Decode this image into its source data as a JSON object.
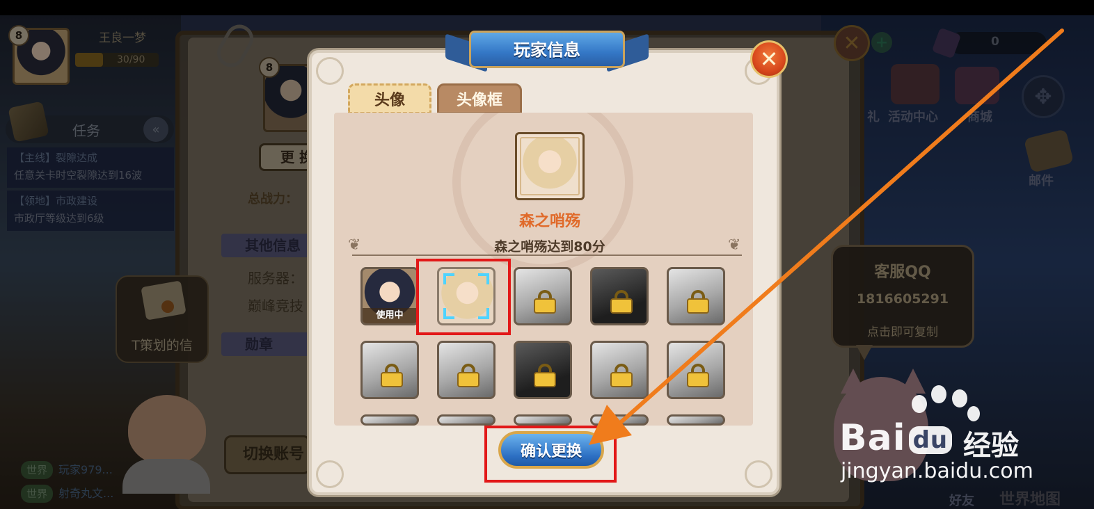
{
  "hud": {
    "player_level": "8",
    "player_name": "王良一梦",
    "exp_text": "30/90",
    "exp_ratio": 0.33,
    "currency_value": "0",
    "activity_center_label": "活动中心",
    "shop_label": "商城",
    "mail_label": "邮件",
    "side_label": "礼",
    "world_map_label": "世界地图",
    "friends_label": "好友"
  },
  "tasks": {
    "title": "任务",
    "items": [
      {
        "tag": "【主线】裂隙达成",
        "desc": "任意关卡时空裂隙达到16波"
      },
      {
        "tag": "【领地】市政建设",
        "desc": "市政厅等级达到6级"
      }
    ]
  },
  "letter": {
    "label": "T策划的信"
  },
  "chat": [
    {
      "channel": "世界",
      "text": "玩家979..."
    },
    {
      "channel": "世界",
      "text": "射奇丸文..."
    }
  ],
  "profile_bg": {
    "level": "8",
    "change_button": "更 换",
    "power_label": "总战力：",
    "other_info": "其他信息",
    "server_label": "服务器：",
    "arena_label": "巅峰竞技",
    "medal_label": "勋章",
    "switch_account": "切换账号"
  },
  "customer_service": {
    "title": "客服QQ",
    "number": "1816605291",
    "hint": "点击即可复制"
  },
  "modal": {
    "title": "玩家信息",
    "close_symbol": "✕",
    "tabs": [
      {
        "label": "头像",
        "active": true
      },
      {
        "label": "头像框",
        "active": false
      }
    ],
    "selected_name": "森之哨殇",
    "selected_condition": "森之哨殇达到80分",
    "in_use_label": "使用中",
    "confirm_label": "确认更换",
    "avatars": [
      {
        "state": "in-use"
      },
      {
        "state": "selected"
      },
      {
        "state": "locked"
      },
      {
        "state": "locked"
      },
      {
        "state": "locked"
      },
      {
        "state": "locked"
      },
      {
        "state": "locked"
      },
      {
        "state": "locked"
      },
      {
        "state": "locked"
      },
      {
        "state": "locked"
      }
    ]
  },
  "watermark": {
    "brand": "Bai",
    "brand_mid": "du",
    "sub": "经验",
    "url": "jingyan.baidu.com"
  },
  "colors": {
    "annotation_red": "#e21818",
    "arrow_orange": "#f07c1c",
    "name_orange": "#e06a2a"
  }
}
